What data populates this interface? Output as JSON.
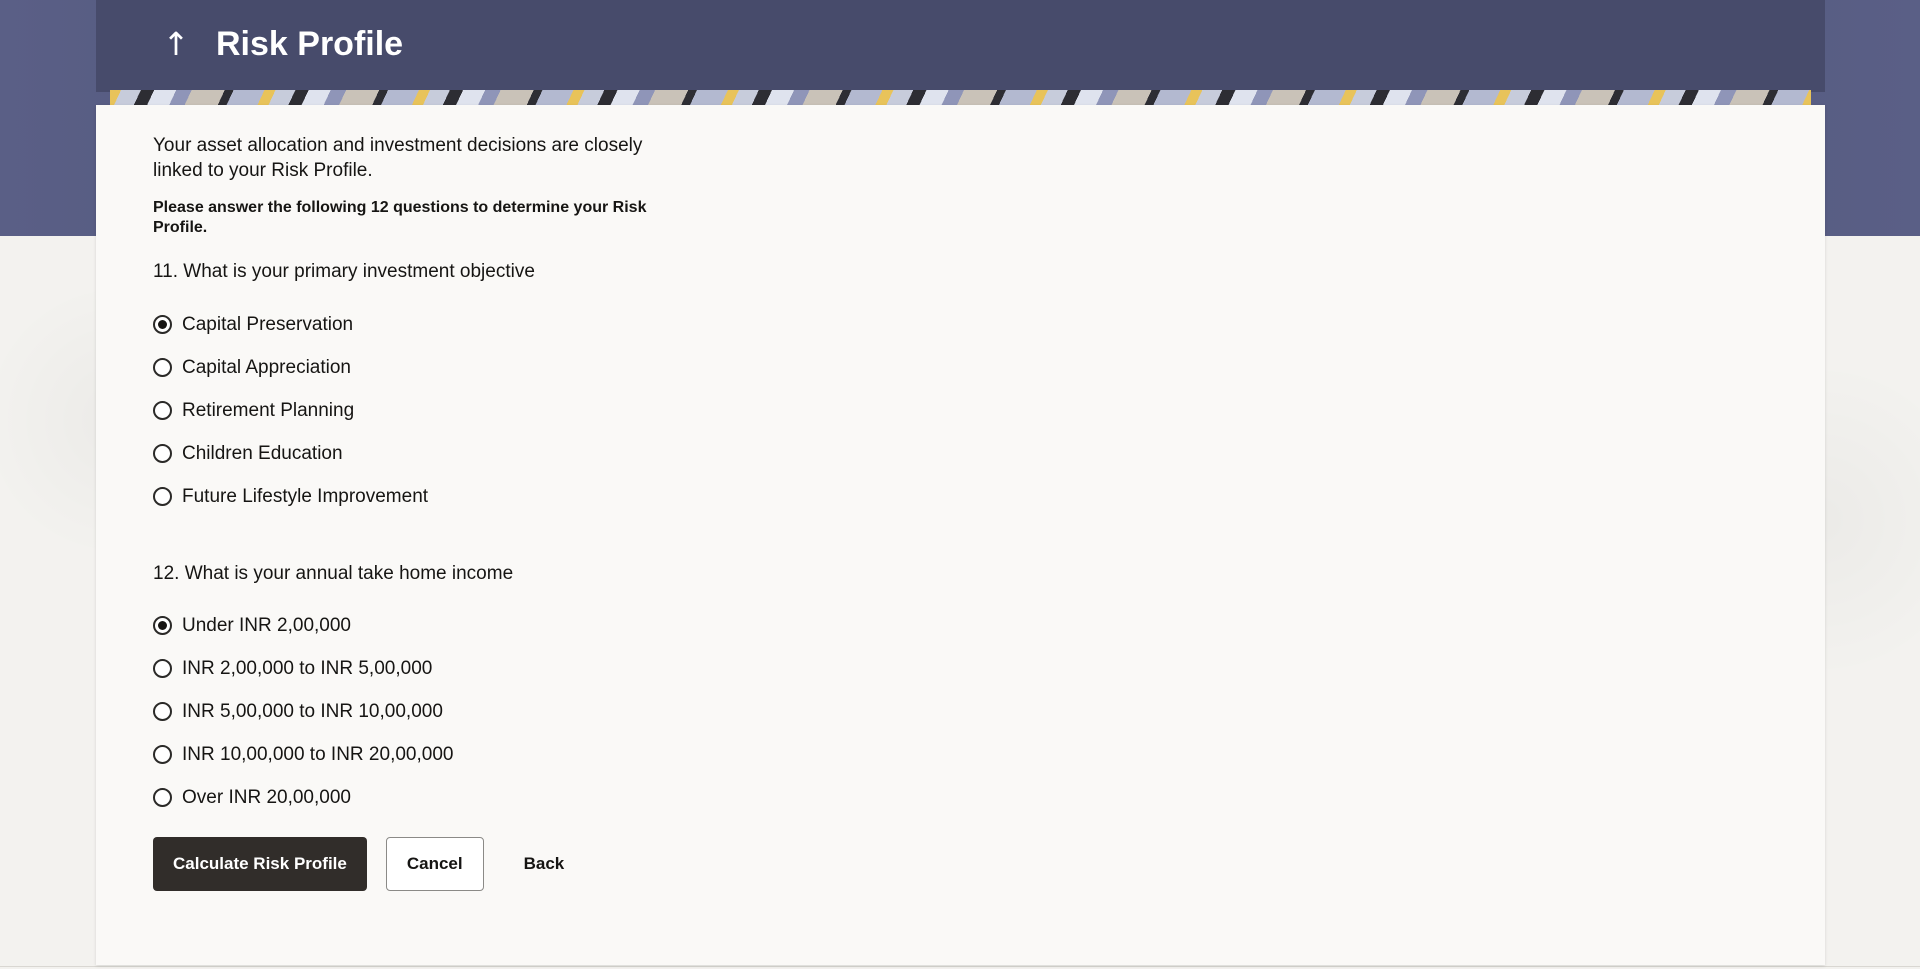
{
  "header": {
    "title": "Risk Profile",
    "back_icon": "arrow-up"
  },
  "intro": {
    "text": "Your asset allocation and investment decisions are closely linked to your Risk Profile.",
    "instruction": "Please answer the following 12 questions to determine your Risk Profile."
  },
  "questions": [
    {
      "label": "11. What is your primary investment objective",
      "options": [
        {
          "label": "Capital Preservation",
          "selected": true
        },
        {
          "label": "Capital Appreciation",
          "selected": false
        },
        {
          "label": "Retirement Planning",
          "selected": false
        },
        {
          "label": "Children Education",
          "selected": false
        },
        {
          "label": "Future Lifestyle Improvement",
          "selected": false
        }
      ]
    },
    {
      "label": "12. What is your annual take home income",
      "options": [
        {
          "label": "Under INR 2,00,000",
          "selected": true
        },
        {
          "label": "INR 2,00,000 to INR 5,00,000",
          "selected": false
        },
        {
          "label": "INR 5,00,000 to INR 10,00,000",
          "selected": false
        },
        {
          "label": "INR 10,00,000 to INR 20,00,000",
          "selected": false
        },
        {
          "label": "Over INR 20,00,000",
          "selected": false
        }
      ]
    }
  ],
  "actions": {
    "calculate_label": "Calculate Risk Profile",
    "cancel_label": "Cancel",
    "back_label": "Back"
  },
  "colors": {
    "header_bg": "#474b6b",
    "primary_button": "#312d2a",
    "card_bg": "#faf9f7"
  }
}
